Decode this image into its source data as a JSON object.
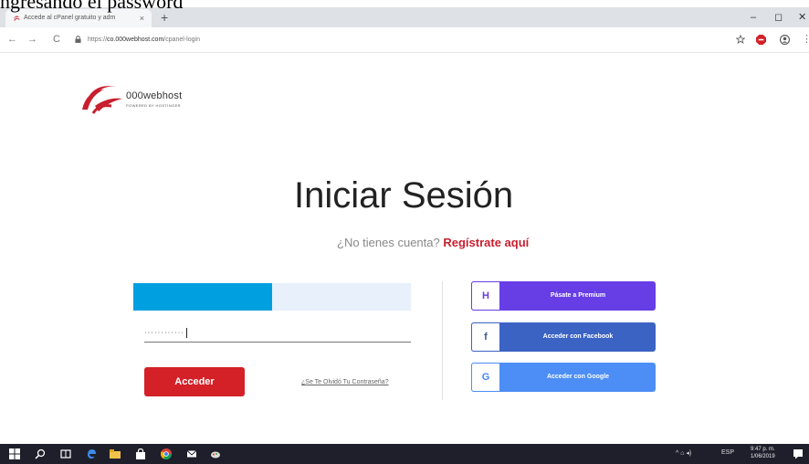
{
  "caption": "ngresando el password",
  "browser": {
    "tab_title": "Accede al cPanel gratuito y adm",
    "tab_close": "×",
    "new_tab": "+",
    "url_scheme": "https://",
    "url_host": "co.000webhost.com",
    "url_path": "/cpanel-login",
    "back": "←",
    "forward": "→",
    "reload": "C",
    "minimize": "–",
    "maximize": "◻",
    "close": "✕"
  },
  "brand": {
    "name": "000webhost",
    "tagline": "POWERED BY HOSTINGER",
    "accent_color": "#c81f2e"
  },
  "login": {
    "title": "Iniciar Sesión",
    "no_account": "¿No tienes cuenta?",
    "register_link": "Regístrate aquí",
    "password_value": "············",
    "submit_label": "Acceder",
    "forgot_link": "¿Se Te Olvidó Tu Contraseña?"
  },
  "social": {
    "premium_label": "Pásate a Premium",
    "premium_icon": "hostinger-icon",
    "premium_glyph": "H",
    "facebook_label": "Acceder con Facebook",
    "facebook_icon": "facebook-icon",
    "facebook_glyph": "f",
    "google_label": "Acceder con Google",
    "google_icon": "google-icon",
    "google_glyph": "G"
  },
  "taskbar": {
    "lang": "ESP",
    "time": "9:47 p. m.",
    "date": "1/06/2019"
  }
}
